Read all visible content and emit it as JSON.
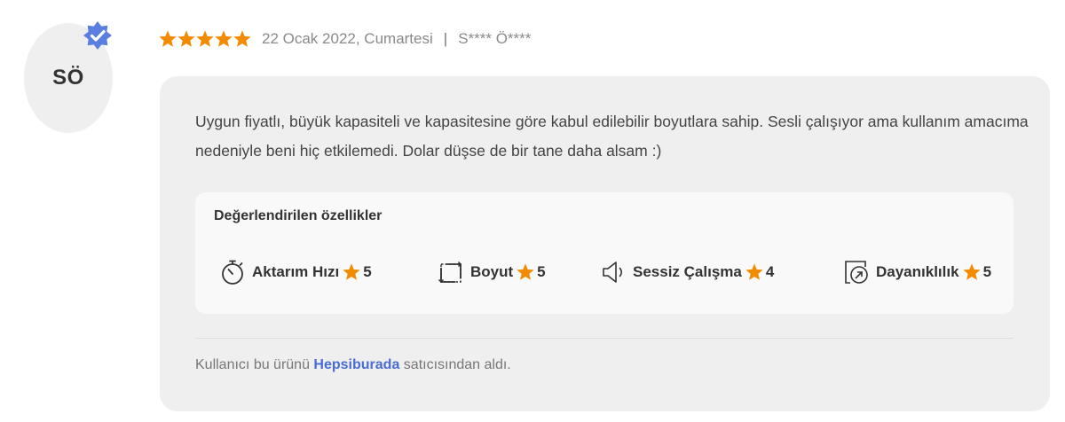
{
  "avatar": {
    "initials": "SÖ",
    "badge": "verified-badge-icon",
    "badge_color": "#5b7fe0"
  },
  "review": {
    "rating": 5,
    "rating_max": 5,
    "star_color": "#f28b00",
    "date": "22 Ocak 2022, Cumartesi",
    "separator": "|",
    "author": "S**** Ö****",
    "text": "Uygun fiyatlı, büyük kapasiteli ve kapasitesine göre kabul edilebilir boyutlara sahip. Sesli çalışıyor ama kullanım amacıma nedeniyle beni hiç etkilemedi. Dolar düşse de bir tane daha alsam :)"
  },
  "features": {
    "title": "Değerlendirilen özellikler",
    "items": [
      {
        "label": "Aktarım Hızı",
        "score": "5",
        "icon": "stopwatch-icon"
      },
      {
        "label": "Boyut",
        "score": "5",
        "icon": "resize-icon"
      },
      {
        "label": "Sessiz Çalışma",
        "score": "4",
        "icon": "speaker-icon"
      },
      {
        "label": "Dayanıklılık",
        "score": "5",
        "icon": "durability-icon"
      }
    ]
  },
  "seller": {
    "prefix": "Kullanıcı bu ürünü ",
    "name": "Hepsiburada",
    "suffix": " satıcısından aldı.",
    "link_color": "#4a6cd4"
  }
}
